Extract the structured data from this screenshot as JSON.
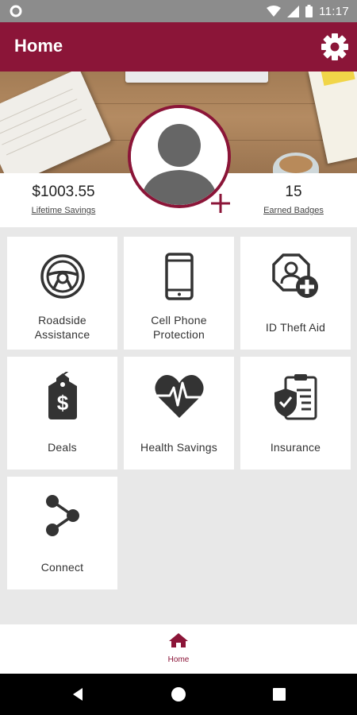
{
  "status_bar": {
    "time": "11:17"
  },
  "app_bar": {
    "title": "Home"
  },
  "profile": {
    "lifetime_savings_value": "$1003.55",
    "lifetime_savings_label": "Lifetime Savings",
    "badges_value": "15",
    "badges_label": "Earned Badges"
  },
  "tiles": [
    {
      "label": "Roadside Assistance",
      "line1": "Roadside",
      "line2": "Assistance",
      "icon": "steering-wheel-icon"
    },
    {
      "label": "Cell Phone Protection",
      "line1": "Cell Phone",
      "line2": "Protection",
      "icon": "phone-icon"
    },
    {
      "label": "ID Theft Aid",
      "icon": "identity-plus-icon"
    },
    {
      "label": "Deals",
      "icon": "price-tag-icon"
    },
    {
      "label": "Health Savings",
      "icon": "heart-pulse-icon"
    },
    {
      "label": "Insurance",
      "icon": "insurance-clipboard-icon"
    },
    {
      "label": "Connect",
      "icon": "share-icon"
    }
  ],
  "bottom_nav": {
    "home_label": "Home"
  },
  "colors": {
    "brand": "#8b1538",
    "status_bar": "#8c8c8c",
    "background": "#e8e8e8"
  }
}
